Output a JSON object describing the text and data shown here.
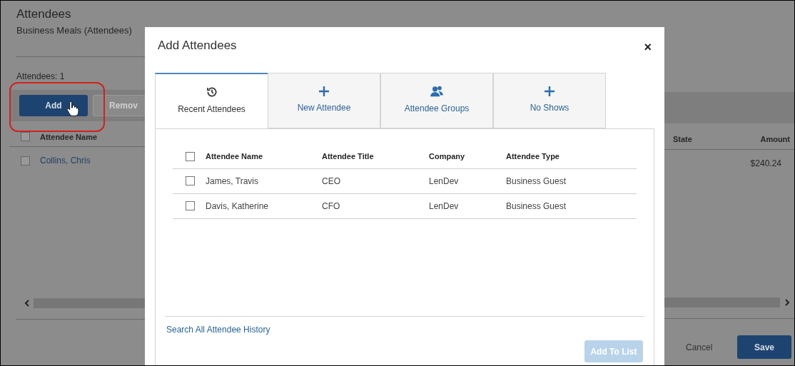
{
  "page": {
    "title": "Attendees",
    "subtitle": "Business Meals (Attendees)",
    "count_label": "Attendees: 1",
    "toolbar": [
      {
        "label": "Add",
        "kind": "primary",
        "highlighted": true
      },
      {
        "label": "Remov",
        "kind": "secondary",
        "highlighted": false
      }
    ],
    "columns": [
      "Attendee Name",
      "State",
      "Amount"
    ],
    "header_checked": false,
    "rows": [
      {
        "name": "Collins, Chris",
        "amount": "$240.24",
        "checked": false
      }
    ],
    "footer": {
      "cancel": "Cancel",
      "save": "Save"
    }
  },
  "modal": {
    "title": "Add Attendees",
    "close": "×",
    "tabs": [
      {
        "label": "Recent Attendees",
        "selected": true
      },
      {
        "label": "New Attendee",
        "selected": false
      },
      {
        "label": "Attendee Groups",
        "selected": false
      },
      {
        "label": "No Shows",
        "selected": false
      }
    ],
    "columns": [
      "Attendee Name",
      "Attendee Title",
      "Company",
      "Attendee Type"
    ],
    "header_checked": false,
    "rows": [
      {
        "cells": [
          "James, Travis",
          "CEO",
          "LenDev",
          "Business Guest"
        ],
        "checked": false
      },
      {
        "cells": [
          "Davis, Katherine",
          "CFO",
          "LenDev",
          "Business Guest"
        ],
        "checked": false
      }
    ],
    "link": "Search All Attendee History",
    "add_button": {
      "label": "Add To List",
      "disabled": true
    }
  }
}
